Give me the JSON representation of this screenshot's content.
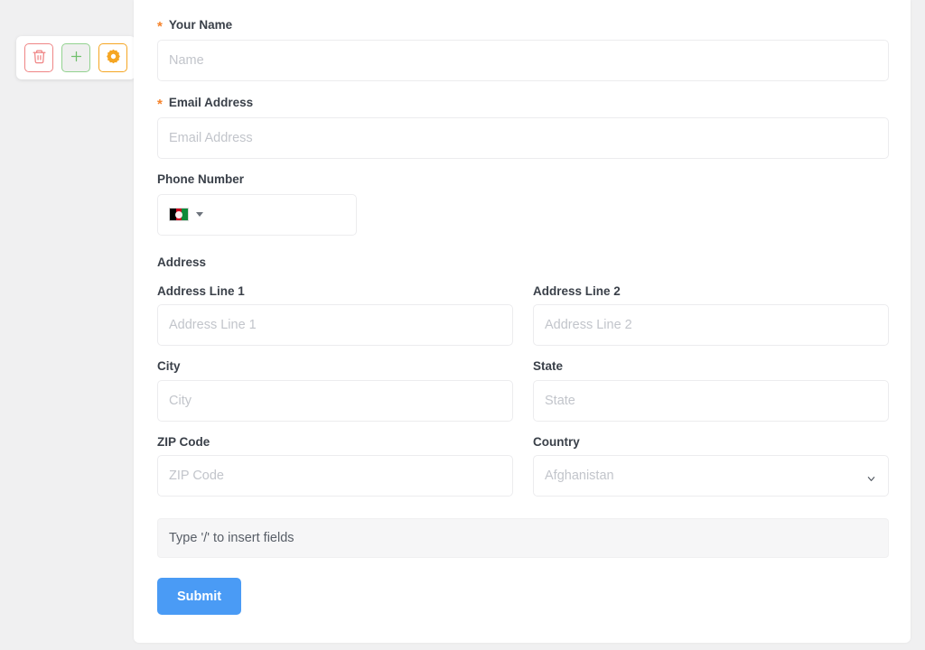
{
  "theme": {
    "page_bg": "#f0f0f1",
    "panel_bg": "#ffffff",
    "accent_blue": "#4a9bf5",
    "required_orange": "#f5822a",
    "delete_red": "#ef8585",
    "add_green": "#92d28f",
    "settings_orange": "#f5a623",
    "label_color": "#3a4049",
    "placeholder_color": "#c2c5cb"
  },
  "toolbar": {
    "delete_label": "Delete",
    "add_label": "Add",
    "settings_label": "Settings",
    "icons": [
      "trash-icon",
      "plus-icon",
      "gear-icon"
    ]
  },
  "form": {
    "fields": {
      "name": {
        "label": "Your Name",
        "required_marker": "*",
        "placeholder": "Name",
        "value": ""
      },
      "email": {
        "label": "Email Address",
        "required_marker": "*",
        "placeholder": "Email Address",
        "value": ""
      },
      "phone": {
        "label": "Phone Number",
        "country_flag": "afghanistan-flag-icon",
        "value": ""
      },
      "address_section": {
        "label": "Address"
      },
      "address_line_1": {
        "label": "Address Line 1",
        "placeholder": "Address Line 1",
        "value": ""
      },
      "address_line_2": {
        "label": "Address Line 2",
        "placeholder": "Address Line 2",
        "value": ""
      },
      "city": {
        "label": "City",
        "placeholder": "City",
        "value": ""
      },
      "state": {
        "label": "State",
        "placeholder": "State",
        "value": ""
      },
      "zip": {
        "label": "ZIP Code",
        "placeholder": "ZIP Code",
        "value": ""
      },
      "country": {
        "label": "Country",
        "selected": "Afghanistan",
        "options": [
          "Afghanistan"
        ]
      }
    },
    "slash_hint": "Type '/' to insert fields",
    "submit_label": "Submit"
  }
}
